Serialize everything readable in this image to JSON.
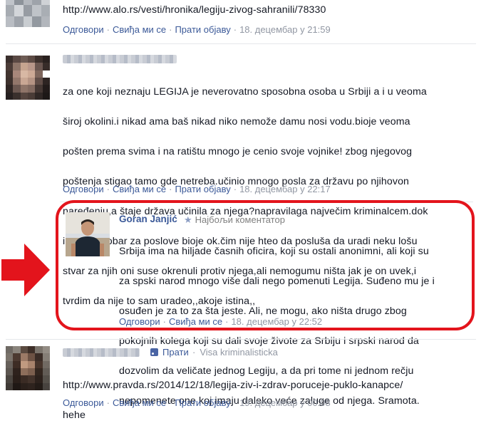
{
  "comments": [
    {
      "link_text": "http://www.alo.rs/vesti/hronika/legiju-zivog-sahranili/78330",
      "actions": {
        "reply": "Одговори",
        "like": "Свиђа ми се",
        "follow": "Прати објаву"
      },
      "timestamp": "18. децембар у 21:59"
    },
    {
      "text_lines": [
        "za one koji neznaju LEGIJA je neverovatno sposobna osoba u Srbiji a i u veoma",
        "široj okolini.i nikad ama baš nikad niko nemože damu nosi vodu.bioje veoma",
        "pošten prema svima i na ratištu mnogo je cenio svoje vojnike! zbog njegovog",
        "poštenja stigao tamo gde netreba.učinio mnogo posla za državu po njihovon",
        "naređenju,a štaje država učinila za njega?napravilaga največim kriminalcem.dok",
        "imje bio dobar za poslove bioje ok.čim nije hteo da posluša da uradi neku lošu",
        "stvar za njih oni suse okrenuli protiv njega,ali nemogumu ništa jak je on uvek,i",
        "tvrdim da nije to sam uradeo,,akoje istina,,"
      ],
      "actions": {
        "reply": "Одговори",
        "like": "Свиђа ми се",
        "follow": "Прати објаву"
      },
      "timestamp": "18. децембар у 22:17"
    },
    {
      "author": "Goran Janjić",
      "badge": "Најбољи коментатор",
      "text_lines": [
        "Srbija ima na hiljade časnih oficira, koji su ostali anonimni, ali koji su",
        "za spski narod mnogo više dali nego pomenuti Legija. Suđeno mu je i",
        "osuđen je za to za šta jeste. Ali, ne mogu, ako ništa drugo zbog",
        "pokojnih kolega koji su dali svoje živote za Srbiju i srpski narod da",
        "dozvolim da veličate jednog Legiju, a da pri tome ni jednom rečju",
        "nepomenete one koj imaju daleko veće zaluge od njega. Sramota."
      ],
      "actions": {
        "reply": "Одговори",
        "like": "Свиђа ми се"
      },
      "timestamp": "18. децембар у 22:52"
    },
    {
      "follow_label": "Прати",
      "subtitle": "Visa kriminalisticka",
      "text_lines": [
        "http://www.pravda.rs/2014/12/18/legija-ziv-i-zdrav-poruceje-puklo-kanapce/",
        "hehe"
      ],
      "actions": {
        "reply": "Одговори",
        "like": "Свиђа ми се",
        "follow": "Прати објаву"
      },
      "timestamp": "19. децембар у 00:08"
    }
  ],
  "colors": {
    "link": "#3b5998",
    "meta": "#9197a3",
    "highlight": "#e3141c"
  },
  "icons": [
    "star-icon",
    "rss-icon",
    "red-arrow-icon"
  ]
}
